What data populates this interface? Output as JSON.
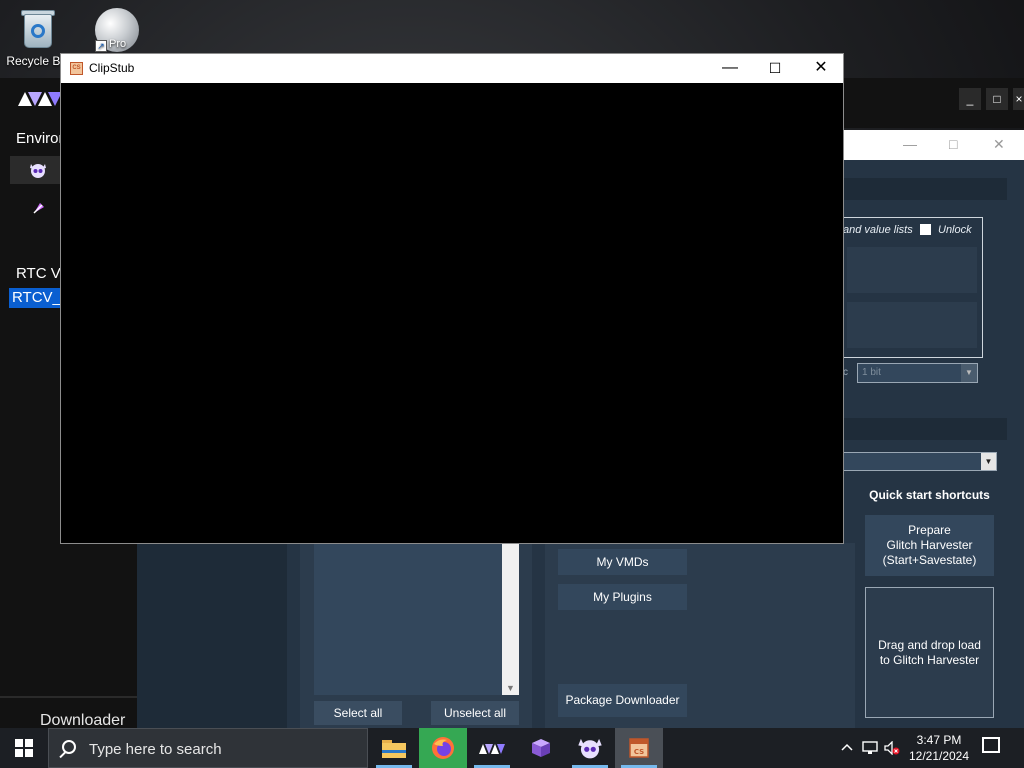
{
  "desktop": {
    "icons": [
      {
        "label": "Recycle Bin"
      },
      {
        "label": "Pro"
      }
    ]
  },
  "rtcv": {
    "env_label": "Environ",
    "version_label": "RTC Ve",
    "version_link": "RTCV_",
    "downloader_label": "Downloader",
    "ctl_minimize": "_",
    "ctl_maximize": "□",
    "ctl_close": "×"
  },
  "glitch_harvester": {
    "lists_label": "and value lists",
    "unlock_label": "Unlock",
    "small_combo_value": "1 bit",
    "small_combo_prefix": "c",
    "buttons": {
      "select_all": "Select all",
      "unselect_all": "Unselect all",
      "my_vmds": "My VMDs",
      "my_plugins": "My Plugins",
      "package_downloader": "Package Downloader"
    },
    "quick_start_title": "Quick start shortcuts",
    "prepare_lines": [
      "Prepare",
      "Glitch Harvester",
      "(Start+Savestate)"
    ],
    "dragdrop_lines": [
      "Drag and drop load",
      "to Glitch Harvester"
    ]
  },
  "clipstub": {
    "title": "ClipStub",
    "icon_text": "CS"
  },
  "taskbar": {
    "search_placeholder": "Type here to search",
    "apps": [
      {
        "icon": "file-explorer-icon"
      },
      {
        "icon": "firefox-icon"
      },
      {
        "icon": "rtcv-icon"
      },
      {
        "icon": "cube-icon"
      },
      {
        "icon": "glitch-harvester-icon"
      },
      {
        "icon": "clipstub-icon",
        "active": true
      }
    ],
    "clock_time": "3:47 PM",
    "clock_date": "12/21/2024"
  },
  "colors": {
    "accent_blue": "#0a5fd1",
    "harvester_bg": "#253444",
    "taskbar_bg": "#1c1f24"
  }
}
